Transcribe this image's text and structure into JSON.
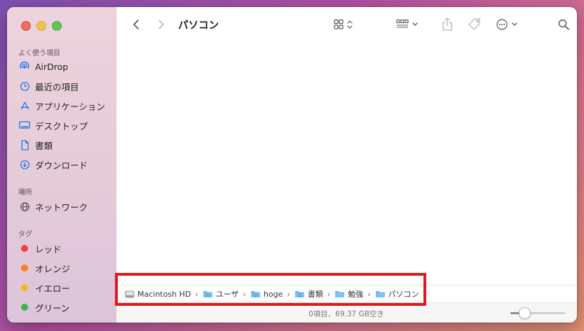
{
  "window": {
    "title": "パソコン"
  },
  "sidebar": {
    "sections": [
      {
        "title": "よく使う項目",
        "items": [
          {
            "label": "AirDrop",
            "icon": "airdrop-icon"
          },
          {
            "label": "最近の項目",
            "icon": "clock-icon"
          },
          {
            "label": "アプリケーション",
            "icon": "applications-icon"
          },
          {
            "label": "デスクトップ",
            "icon": "desktop-icon"
          },
          {
            "label": "書類",
            "icon": "document-icon"
          },
          {
            "label": "ダウンロード",
            "icon": "download-icon"
          }
        ]
      },
      {
        "title": "場所",
        "items": [
          {
            "label": "ネットワーク",
            "icon": "globe-icon"
          }
        ]
      },
      {
        "title": "タグ",
        "items": [
          {
            "label": "レッド",
            "color": "#f0433a"
          },
          {
            "label": "オレンジ",
            "color": "#f7821b"
          },
          {
            "label": "イエロー",
            "color": "#f8b51a"
          },
          {
            "label": "グリーン",
            "color": "#39b54a"
          }
        ]
      }
    ]
  },
  "pathbar": [
    {
      "label": "Macintosh HD",
      "icon": "hard-drive-icon"
    },
    {
      "label": "ユーザ",
      "icon": "folder-icon"
    },
    {
      "label": "hoge",
      "icon": "home-folder-icon"
    },
    {
      "label": "書類",
      "icon": "folder-icon"
    },
    {
      "label": "勉強",
      "icon": "folder-icon"
    },
    {
      "label": "パソコン",
      "icon": "folder-icon"
    }
  ],
  "status": {
    "text": "0項目、69.37 GB空き",
    "zoom_level": 0.25
  },
  "colors": {
    "accent": "#1a73e8",
    "highlight": "#e3161f"
  }
}
